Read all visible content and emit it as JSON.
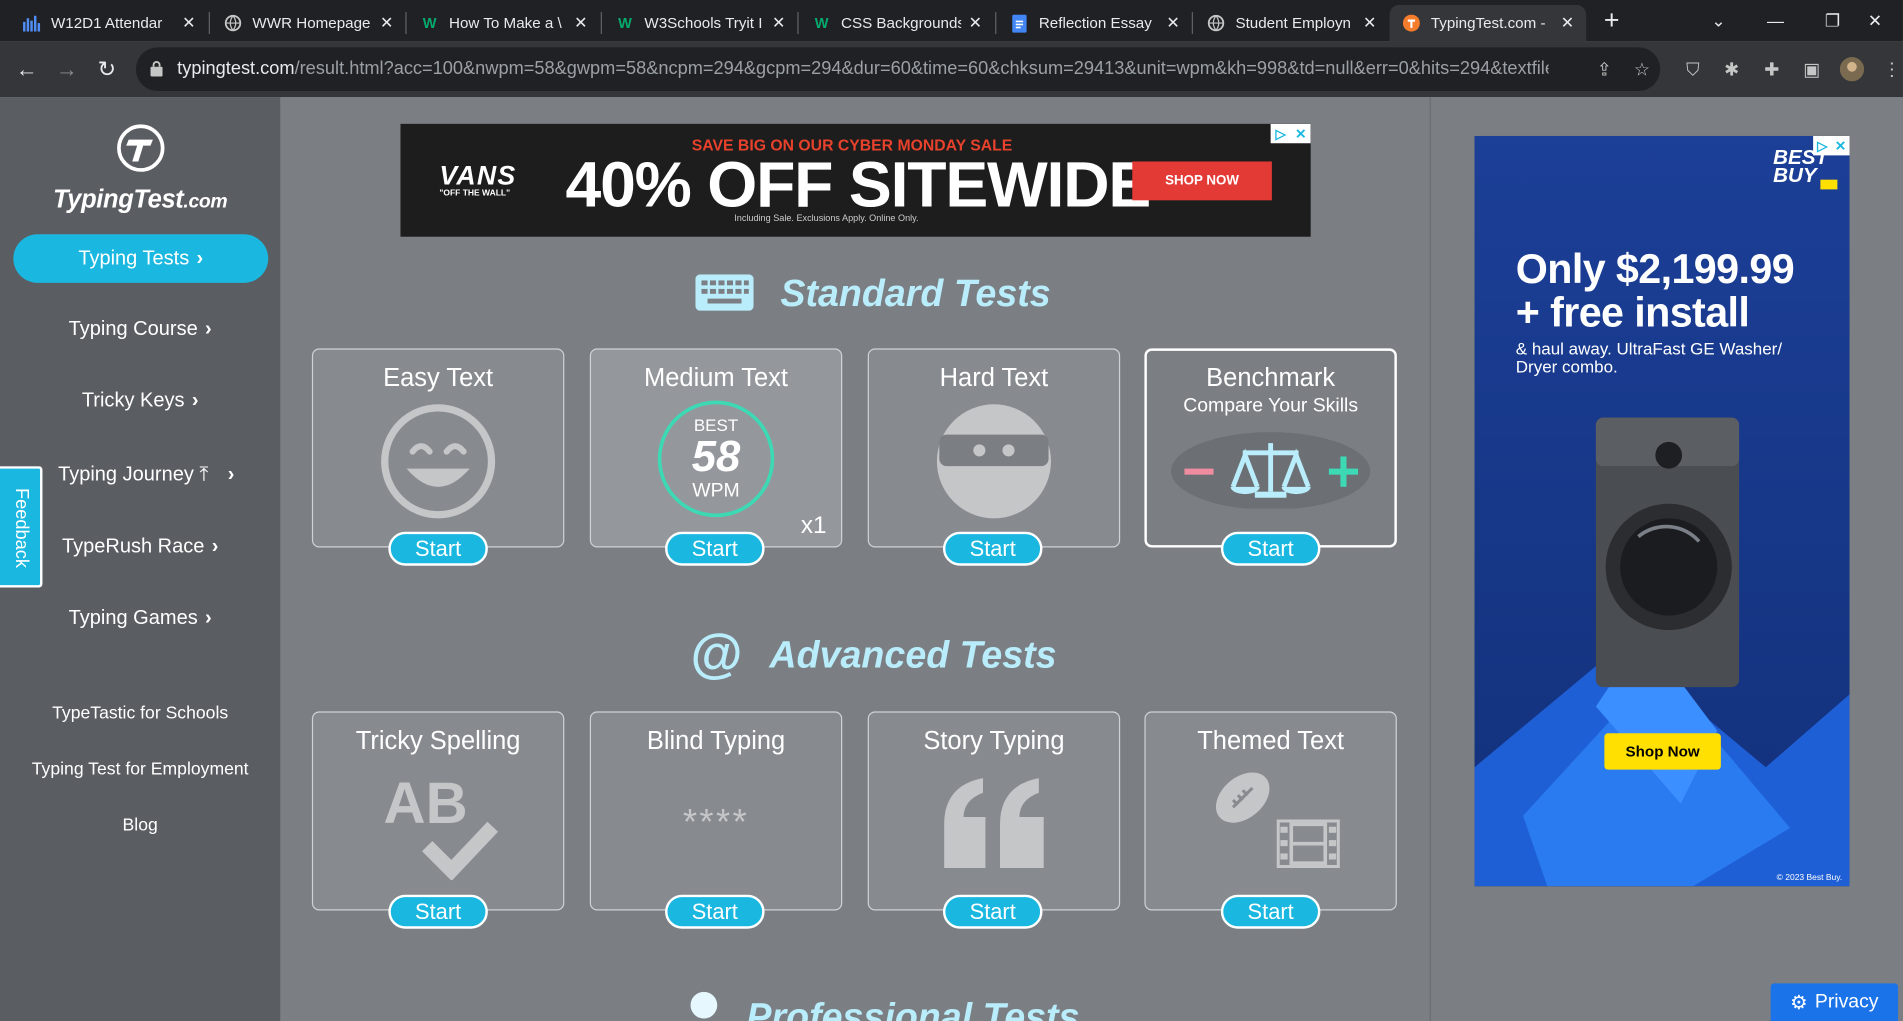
{
  "browser": {
    "tabs": [
      {
        "title": "W12D1 Attendar",
        "icon": "chart-favicon-icon"
      },
      {
        "title": "WWR Homepage",
        "icon": "globe-favicon-icon"
      },
      {
        "title": "How To Make a \\",
        "icon": "w3schools-favicon-icon"
      },
      {
        "title": "W3Schools Tryit I",
        "icon": "w3schools-favicon-icon"
      },
      {
        "title": "CSS Backgrounds",
        "icon": "w3schools-favicon-icon"
      },
      {
        "title": "Reflection Essay",
        "icon": "docs-favicon-icon"
      },
      {
        "title": "Student Employn",
        "icon": "globe-favicon-icon"
      },
      {
        "title": "TypingTest.com -",
        "icon": "typingtest-favicon-icon"
      }
    ],
    "url_host": "typingtest.com",
    "url_path": "/result.html?acc=100&nwpm=58&gwpm=58&ncpm=294&gcpm=294&dur=60&time=60&chksum=29413&unit=wpm&kh=998&td=null&err=0&hits=294&textfile..."
  },
  "sidebar": {
    "logo_name": "TypingTest",
    "logo_suffix": ".com",
    "nav": [
      {
        "label": "Typing Tests",
        "active": true
      },
      {
        "label": "Typing Course"
      },
      {
        "label": "Tricky Keys"
      },
      {
        "label": "Typing Journey"
      },
      {
        "label": "TypeRush Race"
      },
      {
        "label": "Typing Games"
      }
    ],
    "links": [
      "TypeTastic for Schools",
      "Typing Test for Employment",
      "Blog"
    ],
    "feedback": "Feedback"
  },
  "top_ad": {
    "brand": "VANS",
    "brand_tag": "\"OFF THE WALL\"",
    "subhead": "SAVE BIG ON OUR CYBER MONDAY SALE",
    "headline": "40% OFF SITEWIDE",
    "fineprint": "Including Sale. Exclusions Apply. Online Only.",
    "cta": "SHOP NOW"
  },
  "standard": {
    "title": "Standard Tests",
    "cards": [
      {
        "title": "Easy Text",
        "start": "Start"
      },
      {
        "title": "Medium Text",
        "start": "Start",
        "best_label": "BEST",
        "best_value": "58",
        "best_unit": "WPM",
        "count": "x1"
      },
      {
        "title": "Hard Text",
        "start": "Start"
      },
      {
        "title": "Benchmark",
        "subtitle": "Compare Your Skills",
        "start": "Start"
      }
    ]
  },
  "advanced": {
    "title": "Advanced Tests",
    "cards": [
      {
        "title": "Tricky Spelling",
        "start": "Start",
        "icon_text": "AB"
      },
      {
        "title": "Blind Typing",
        "start": "Start",
        "icon_text": "****"
      },
      {
        "title": "Story Typing",
        "start": "Start"
      },
      {
        "title": "Themed Text",
        "start": "Start"
      }
    ]
  },
  "professional": {
    "title": "Professional Tests"
  },
  "side_ad": {
    "brand": "BEST BUY",
    "headline_1": "Only $2,199.99",
    "headline_2": "+ free install",
    "body": "& haul away. UltraFast GE Washer/ Dryer combo.",
    "cta": "Shop Now",
    "copyright": "© 2023 Best Buy."
  },
  "privacy": "Privacy",
  "colors": {
    "accent": "#1ab8e0",
    "page_bg": "#7b7f83",
    "sidebar_bg": "#5a5e62",
    "heading": "#b9edfb",
    "badge_ring": "#3dd9b5"
  }
}
